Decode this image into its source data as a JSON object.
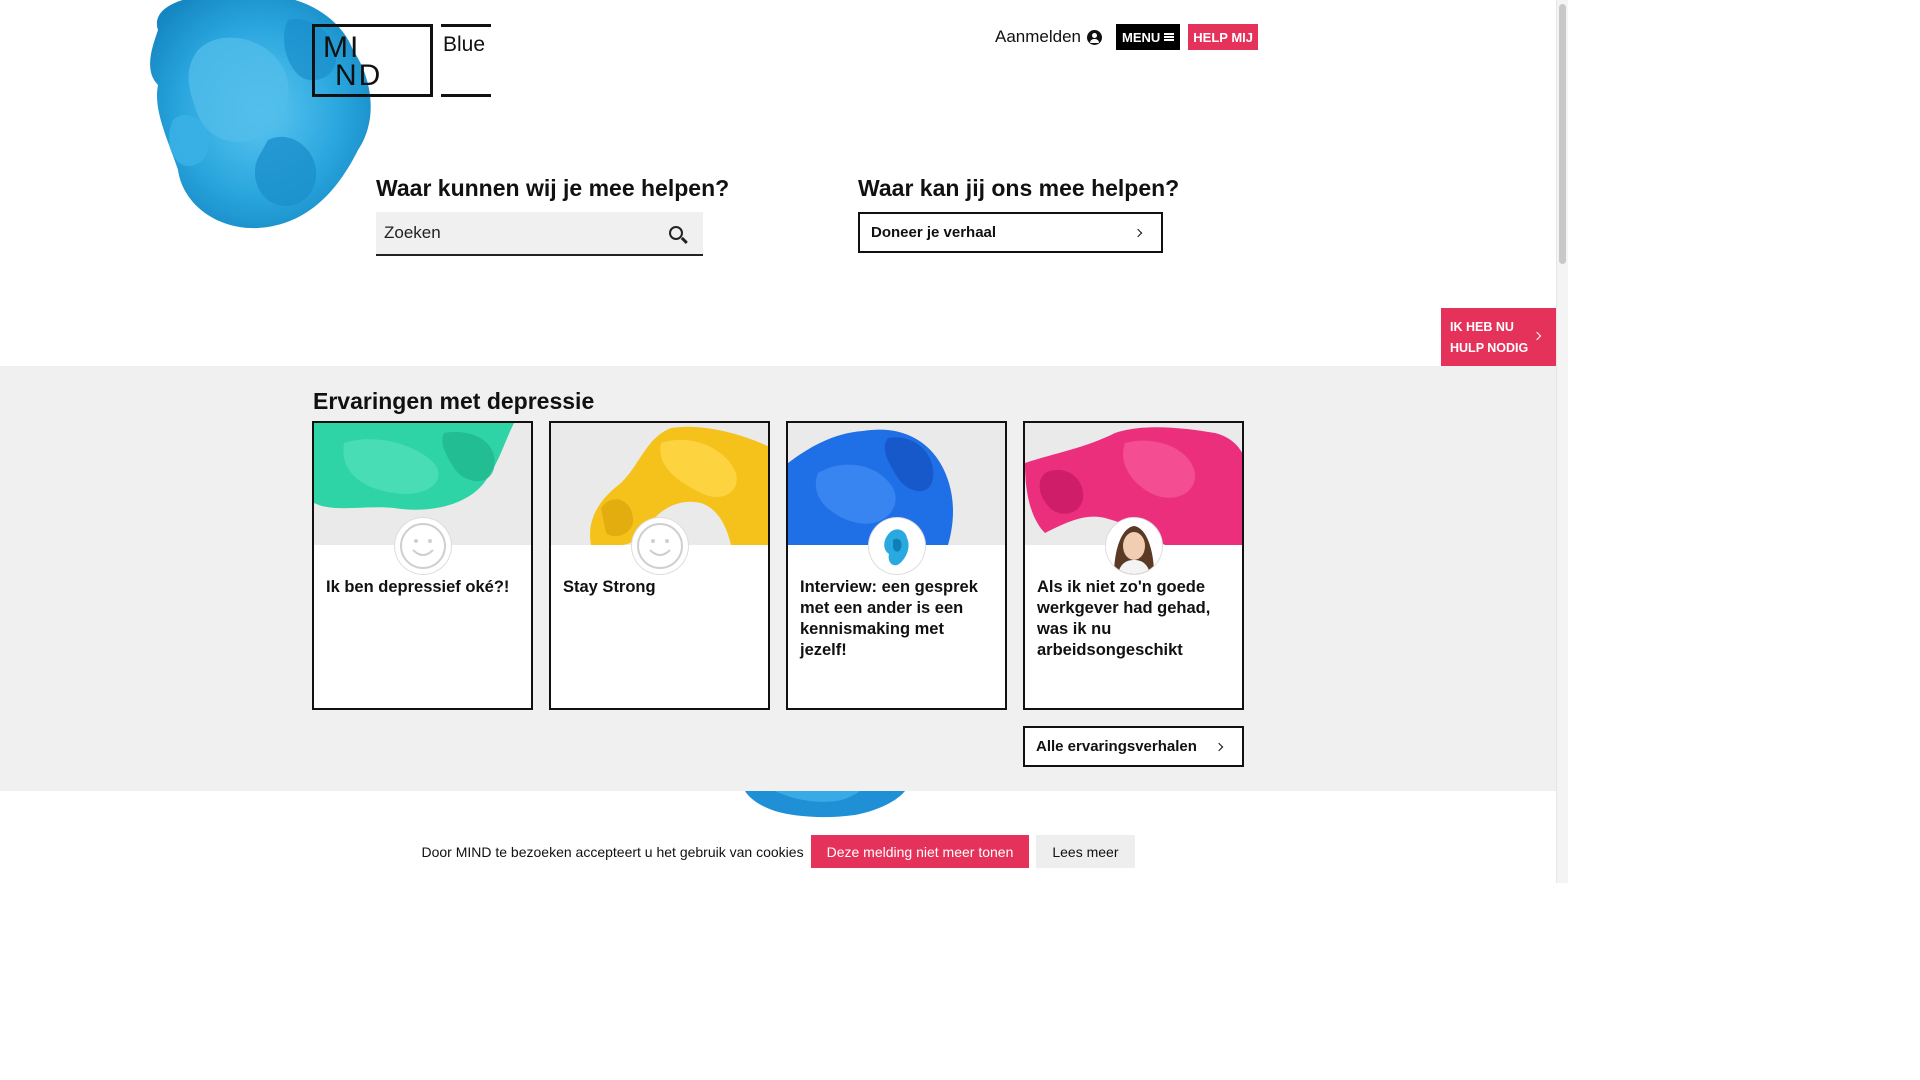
{
  "logo": {
    "line1": "MI",
    "line2": "ND",
    "suffix": "Blue"
  },
  "header": {
    "login_label": "Aanmelden",
    "login_icon": "user-circle-icon",
    "menu_label": "MENU",
    "menu_icon": "hamburger-icon",
    "help_label": "HELP MIJ"
  },
  "hero": {
    "left_title": "Waar kunnen wij je mee helpen?",
    "search_placeholder": "Zoeken",
    "search_icon": "search-icon",
    "right_title": "Waar kan jij ons mee helpen?",
    "donate_label": "Doneer je verhaal"
  },
  "urgent": {
    "line1": "IK HEB NU",
    "line2": "HULP NODIG"
  },
  "experiences": {
    "title": "Ervaringen met depressie",
    "cards": [
      {
        "title": "Ik ben depressief oké?!",
        "ink_color": "#2ed3a6",
        "avatar": "smiley-icon"
      },
      {
        "title": "Stay Strong",
        "ink_color": "#f5c21c",
        "avatar": "smiley-icon"
      },
      {
        "title": "Interview: een gesprek met een ander is een kennismaking met jezelf!",
        "ink_color": "#1f6fe6",
        "avatar": "blue-ink-avatar"
      },
      {
        "title": "Als ik niet zo'n goede werkgever had gehad, was ik nu arbeidsongeschikt",
        "ink_color": "#ec2f7d",
        "avatar": "portrait-avatar"
      }
    ],
    "all_label": "Alle ervaringsverhalen"
  },
  "cookie": {
    "text": "Door MIND te bezoeken accepteert u het gebruik van cookies",
    "accept_label": "Deze melding niet meer tonen",
    "more_label": "Lees meer"
  },
  "colors": {
    "accent": "#e5325a",
    "band": "#f0f0f0",
    "ink_blue": "#29a9e0"
  }
}
